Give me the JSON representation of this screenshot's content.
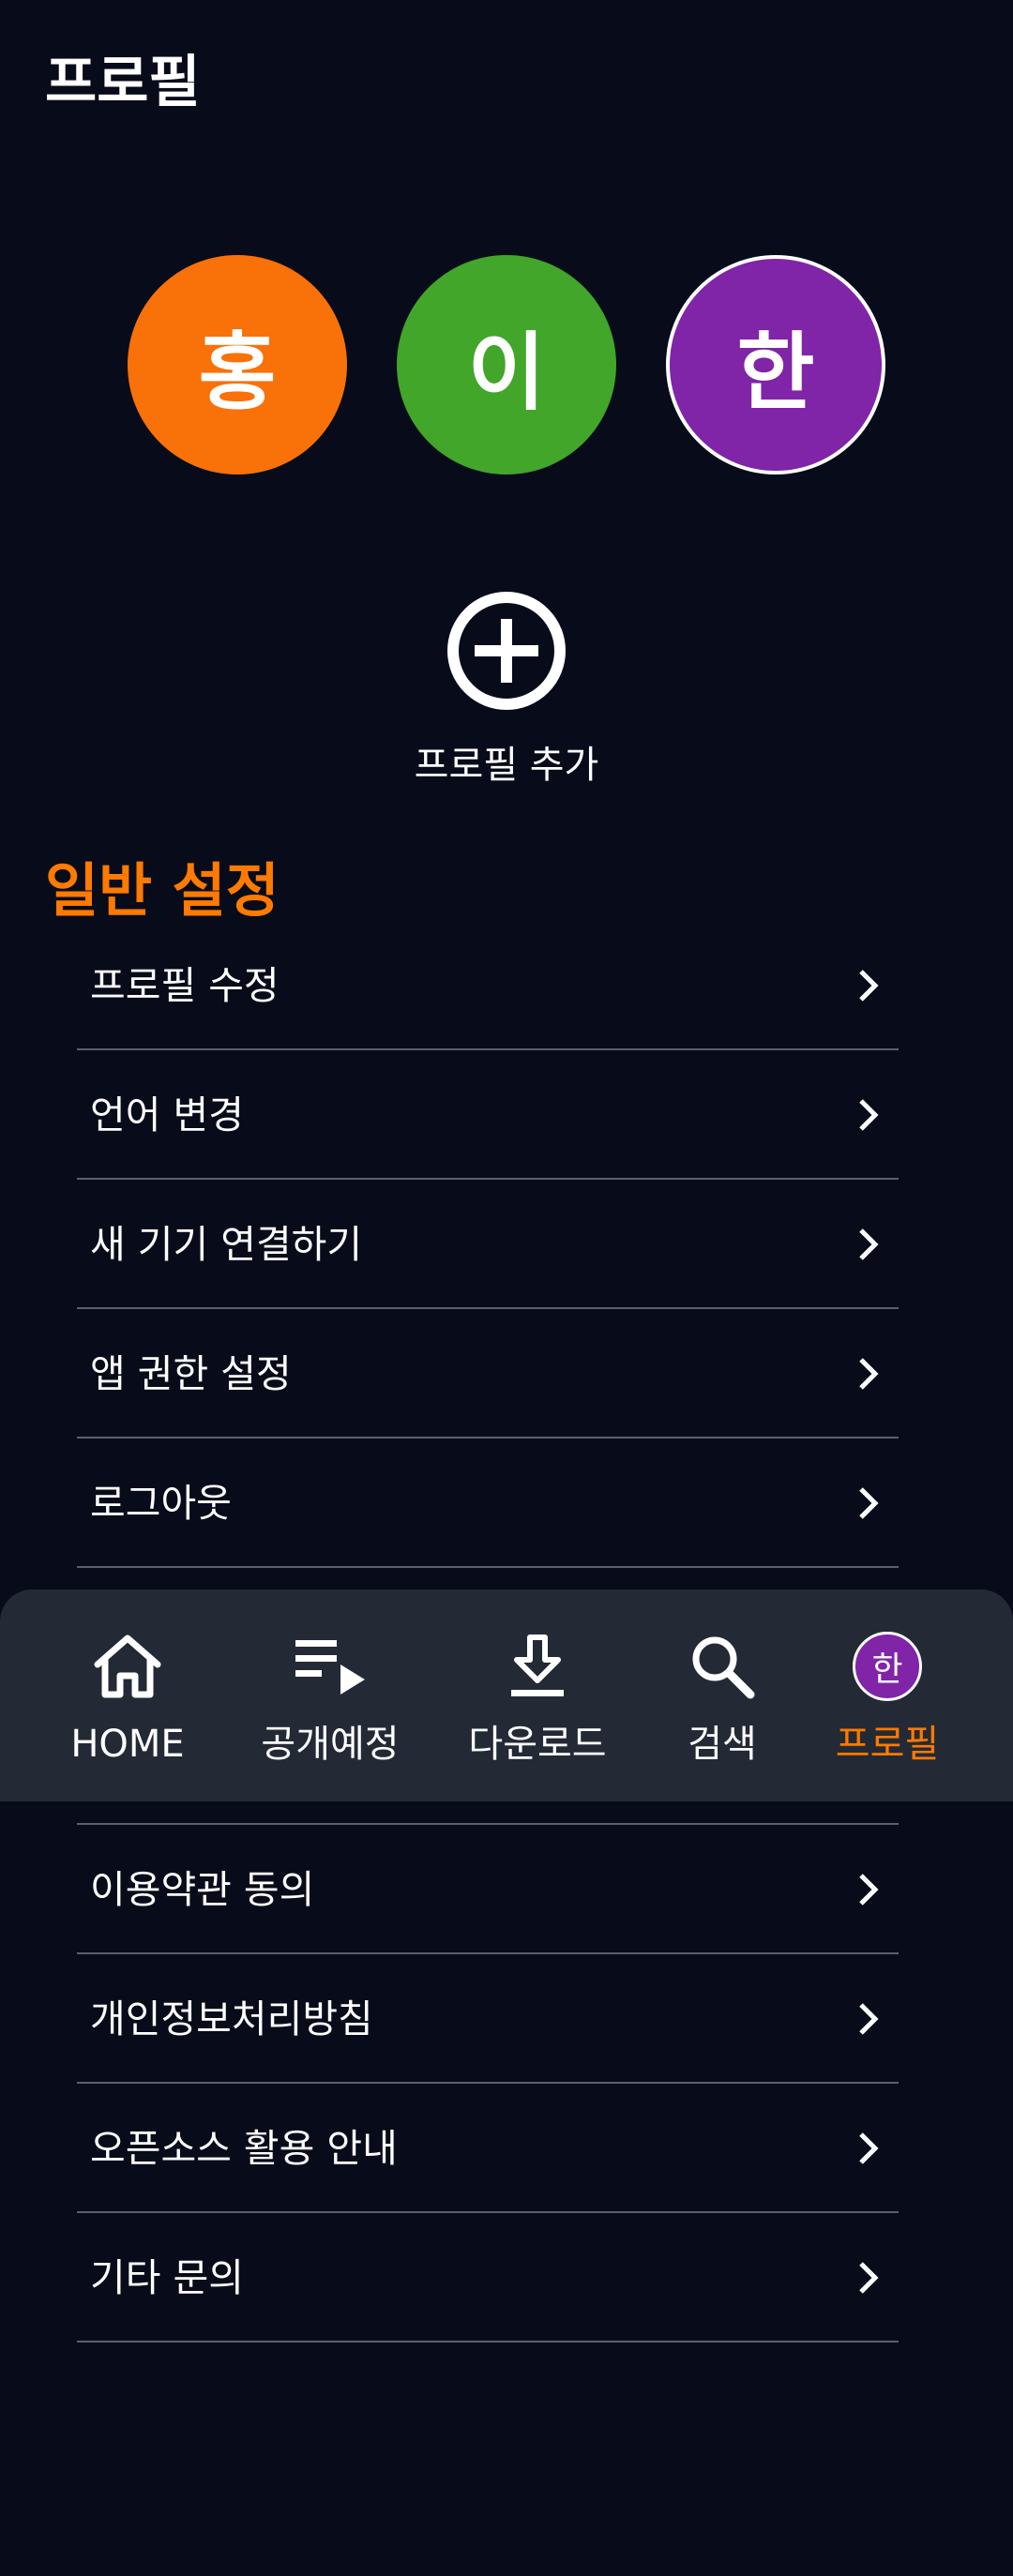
{
  "header": {
    "title": "프로필"
  },
  "profiles": [
    {
      "initial": "홍",
      "color": "#f87109",
      "selected": false
    },
    {
      "initial": "이",
      "color": "#41a62a",
      "selected": false
    },
    {
      "initial": "한",
      "color": "#8024a8",
      "selected": true
    }
  ],
  "add_profile": {
    "label": "프로필 추가",
    "icon": "plus-circle-icon"
  },
  "general_settings": {
    "title": "일반 설정",
    "items": [
      {
        "label": "프로필 수정"
      },
      {
        "label": "언어 변경"
      },
      {
        "label": "새 기기 연결하기"
      },
      {
        "label": "앱 권한 설정"
      },
      {
        "label": "로그아웃"
      }
    ]
  },
  "info": {
    "items": [
      {
        "label": "이용약관 동의"
      },
      {
        "label": "개인정보처리방침"
      },
      {
        "label": "오픈소스 활용 안내"
      },
      {
        "label": "기타 문의"
      }
    ]
  },
  "bottom_nav": {
    "items": [
      {
        "label": "HOME",
        "icon": "home-icon",
        "active": false
      },
      {
        "label": "공개예정",
        "icon": "playlist-icon",
        "active": false
      },
      {
        "label": "다운로드",
        "icon": "download-icon",
        "active": false
      },
      {
        "label": "검색",
        "icon": "search-icon",
        "active": false
      },
      {
        "label": "프로필",
        "icon": "profile-avatar-icon",
        "avatar_initial": "한",
        "active": true
      }
    ]
  },
  "colors": {
    "background": "#080c1a",
    "accent": "#ff7a00",
    "nav_background": "#232a36",
    "divider": "#5c606a"
  }
}
